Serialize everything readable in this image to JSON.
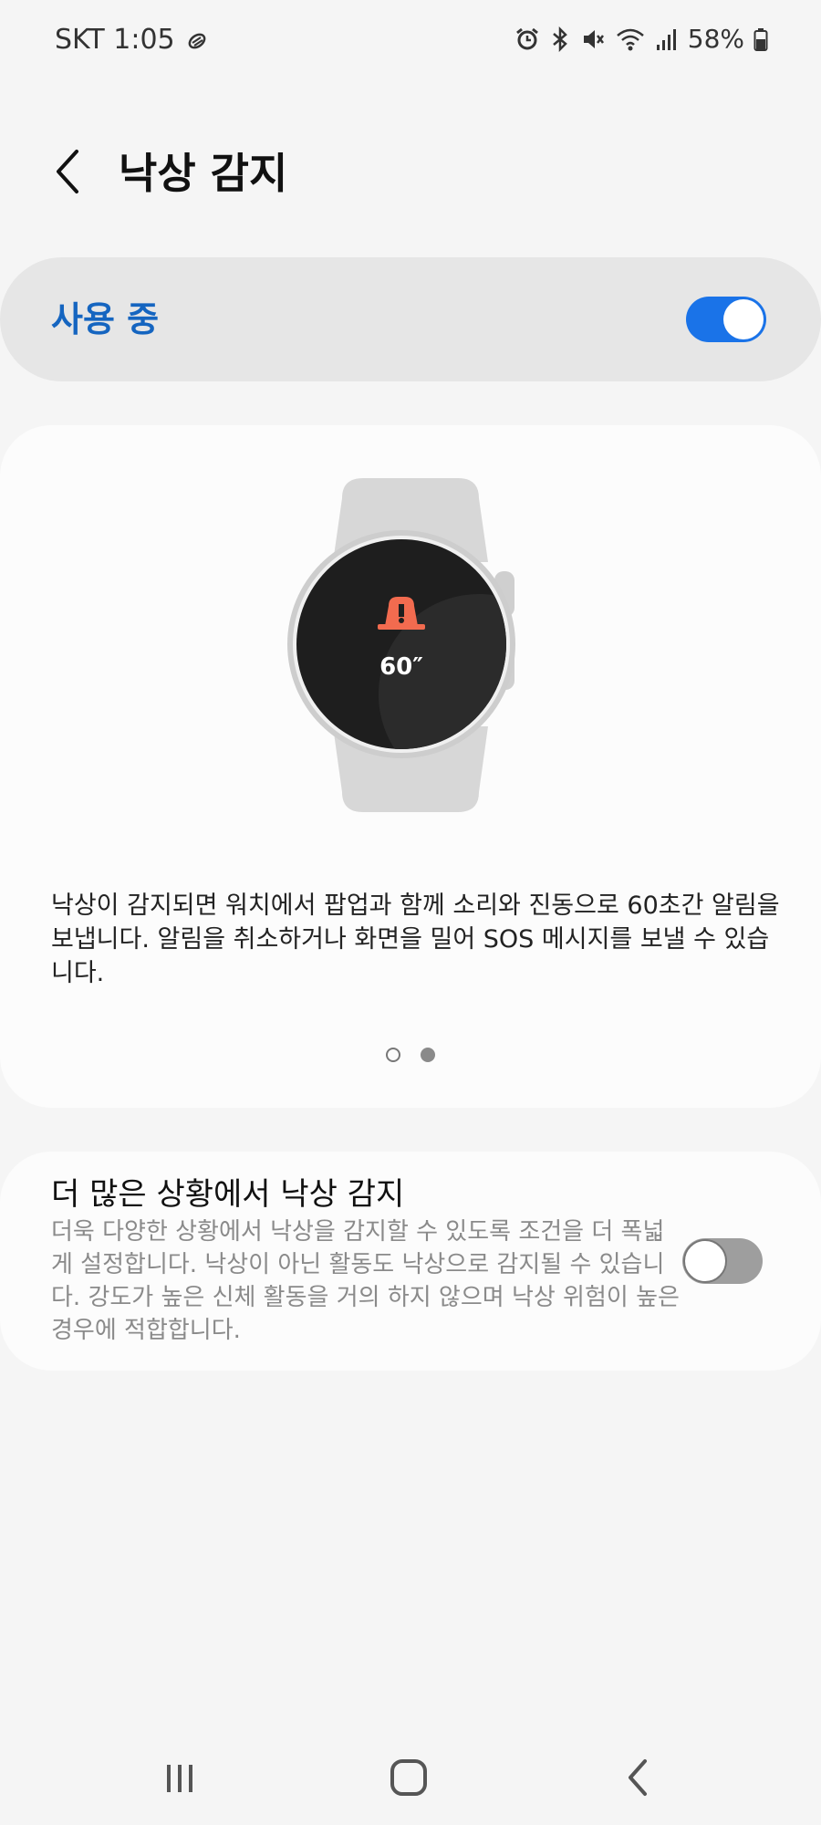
{
  "status_bar": {
    "carrier_time": "SKT 1:05",
    "battery": "58%"
  },
  "header": {
    "title": "낙상 감지"
  },
  "master_switch": {
    "label": "사용 중",
    "enabled": true
  },
  "illustration": {
    "countdown": "60″",
    "description": "낙상이 감지되면 워치에서 팝업과 함께 소리와 진동으로 60초간 알림을 보냅니다. 알림을 취소하거나 화면을 밀어 SOS 메시지를 보낼 수 있습니다.",
    "pages": 2,
    "current_page": 2
  },
  "option": {
    "title": "더 많은 상황에서 낙상 감지",
    "description": "더욱 다양한 상황에서 낙상을 감지할 수 있도록 조건을 더 폭넓게 설정합니다. 낙상이 아닌 활동도 낙상으로 감지될 수 있습니다. 강도가 높은 신체 활동을 거의 하지 않으며 낙상 위험이 높은 경우에 적합합니다.",
    "enabled": false
  },
  "colors": {
    "accent": "#1a73e8",
    "accent_text": "#1565c0",
    "alert_icon": "#f26b4f"
  },
  "icons": {
    "status_left": [
      "steps-icon"
    ],
    "status_right": [
      "alarm-icon",
      "bluetooth-icon",
      "mute-icon",
      "wifi-icon",
      "signal-icon",
      "battery-icon"
    ],
    "nav": [
      "recents-icon",
      "home-icon",
      "back-icon"
    ]
  }
}
